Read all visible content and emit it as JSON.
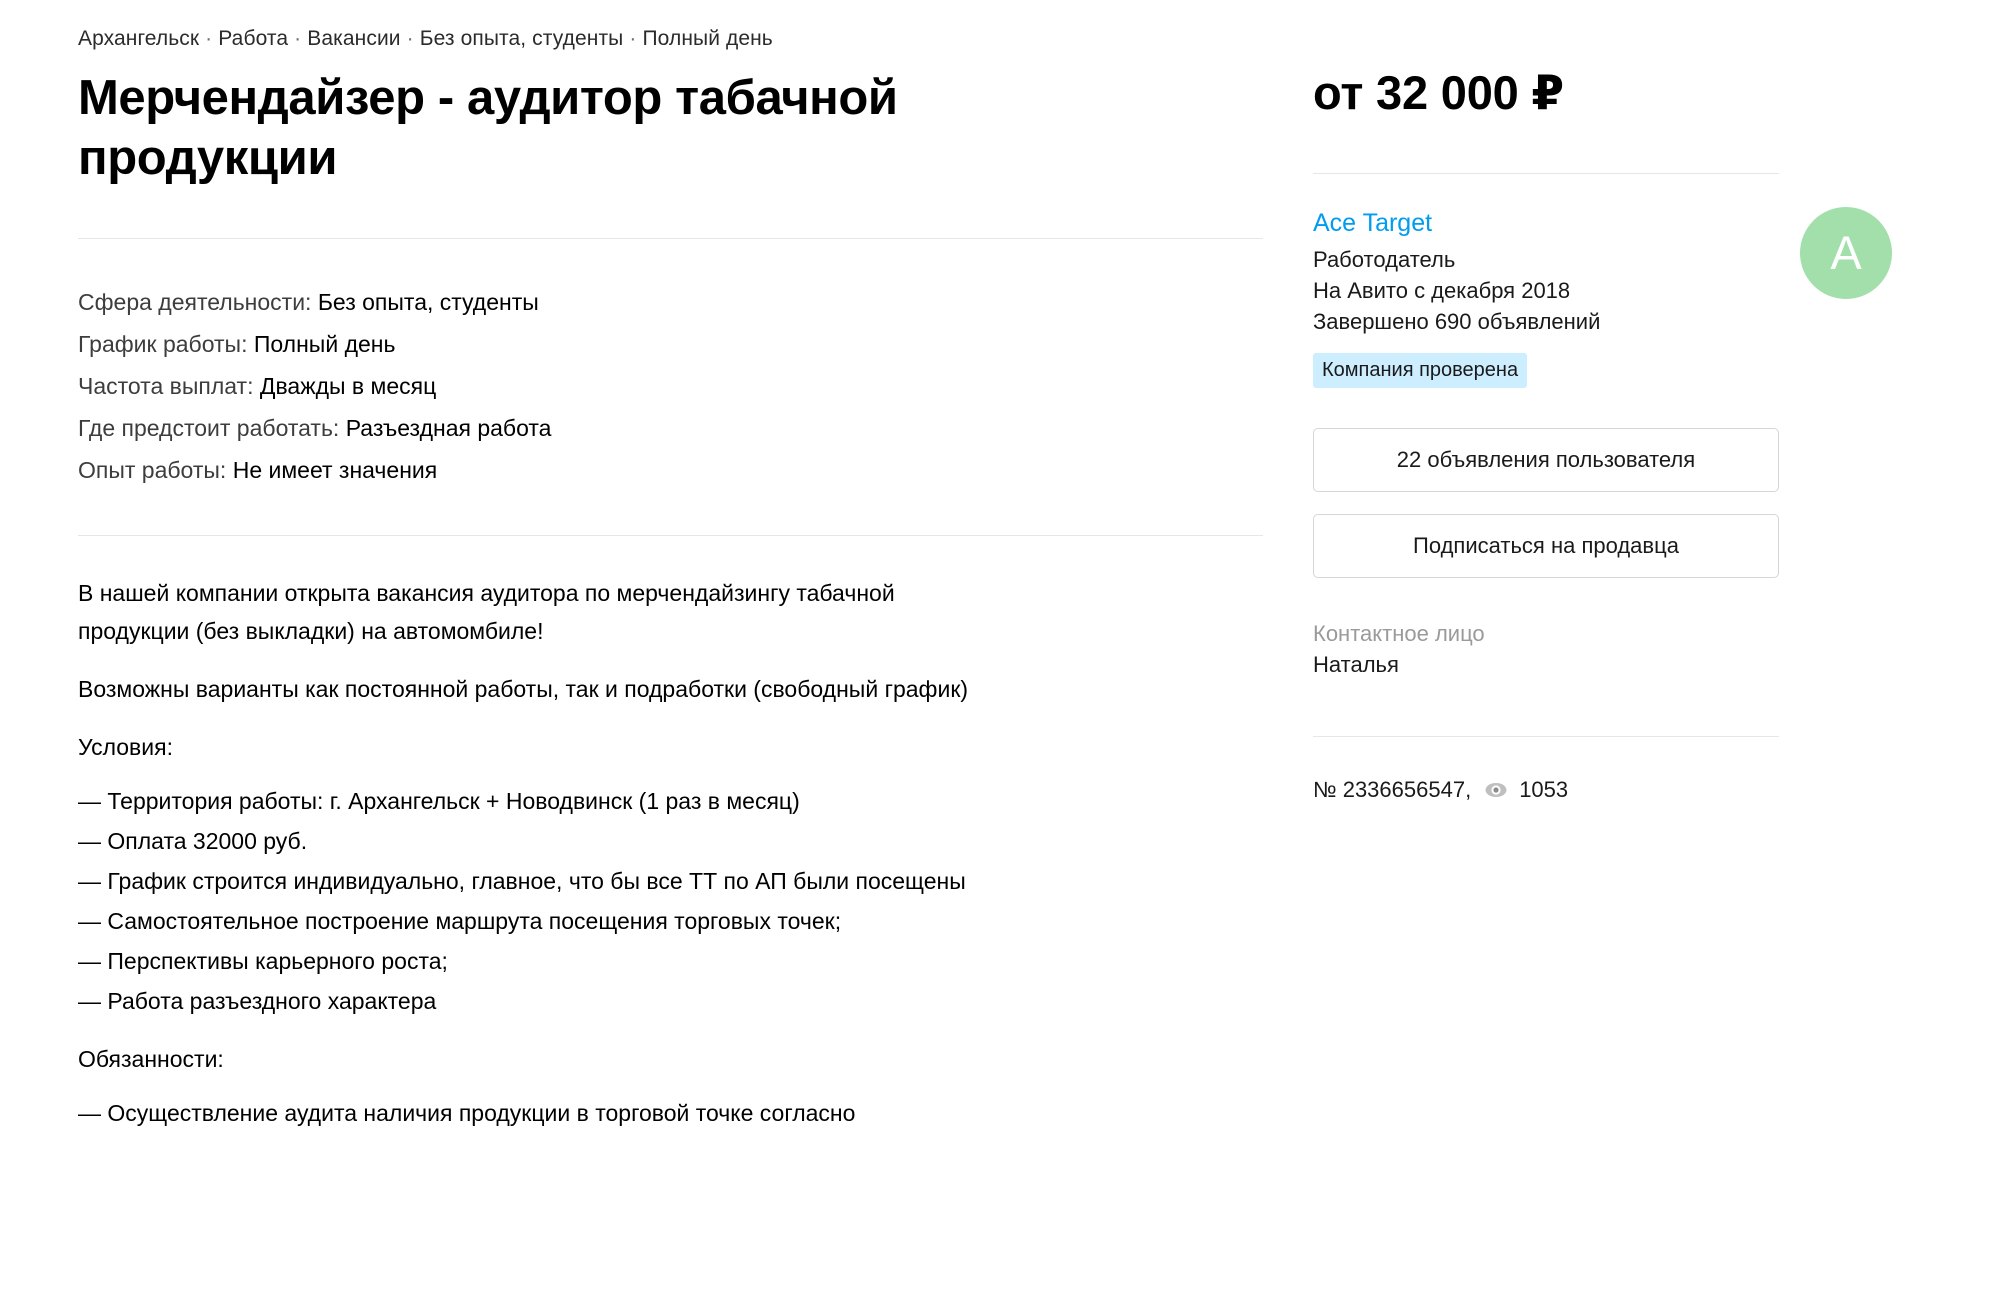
{
  "breadcrumb": {
    "separator": "·",
    "items": [
      "Архангельск",
      "Работа",
      "Вакансии",
      "Без опыта, студенты",
      "Полный день"
    ]
  },
  "listing": {
    "title": "Мерчендайзер - аудитор табачной продукции",
    "price": "от 32 000 ₽"
  },
  "params": [
    {
      "label": "Сфера деятельности:",
      "value": "Без опыта, студенты"
    },
    {
      "label": "График работы:",
      "value": "Полный день"
    },
    {
      "label": "Частота выплат:",
      "value": "Дважды в месяц"
    },
    {
      "label": "Где предстоит работать:",
      "value": "Разъездная работа"
    },
    {
      "label": "Опыт работы:",
      "value": "Не имеет значения"
    }
  ],
  "description": {
    "intro_line_1": "В нашей компании открыта вакансия аудитора по мерчендайзингу табачной",
    "intro_line_2": "продукции (без выкладки) на автомомбиле!",
    "paragraph_2": "Возможны варианты как постоянной работы, так и подработки (свободный график)",
    "conditions_heading": "Условия:",
    "conditions": [
      "— Территория работы: г. Архангельск + Новодвинск (1 раз в месяц)",
      "— Оплата 32000 руб.",
      "— График строится индивидуально, главное, что бы все ТТ по АП были посещены",
      "— Самостоятельное построение маршрута посещения торговых точек;",
      "— Перспективы карьерного роста;",
      "— Работа разъездного характера"
    ],
    "duties_heading": "Обязанности:",
    "duties": [
      "— Осуществление аудита наличия продукции в торговой точке согласно"
    ]
  },
  "seller": {
    "name": "Ace Target",
    "role": "Работодатель",
    "member_since": "На Авито с декабря 2018",
    "completed_ads": "Завершено 690 объявлений",
    "verified_badge": "Компания проверена",
    "avatar_letter": "A",
    "avatar_color": "#a2dfab",
    "link_color": "#009cf0",
    "badge_bg": "#cceeff",
    "buttons": {
      "user_ads": "22 объявления пользователя",
      "subscribe": "Подписаться на продавца"
    },
    "contact_label": "Контактное лицо",
    "contact_name": "Наталья"
  },
  "ad_meta": {
    "number": "№ 2336656547,",
    "views": "1053",
    "views_icon": "eye-icon"
  }
}
